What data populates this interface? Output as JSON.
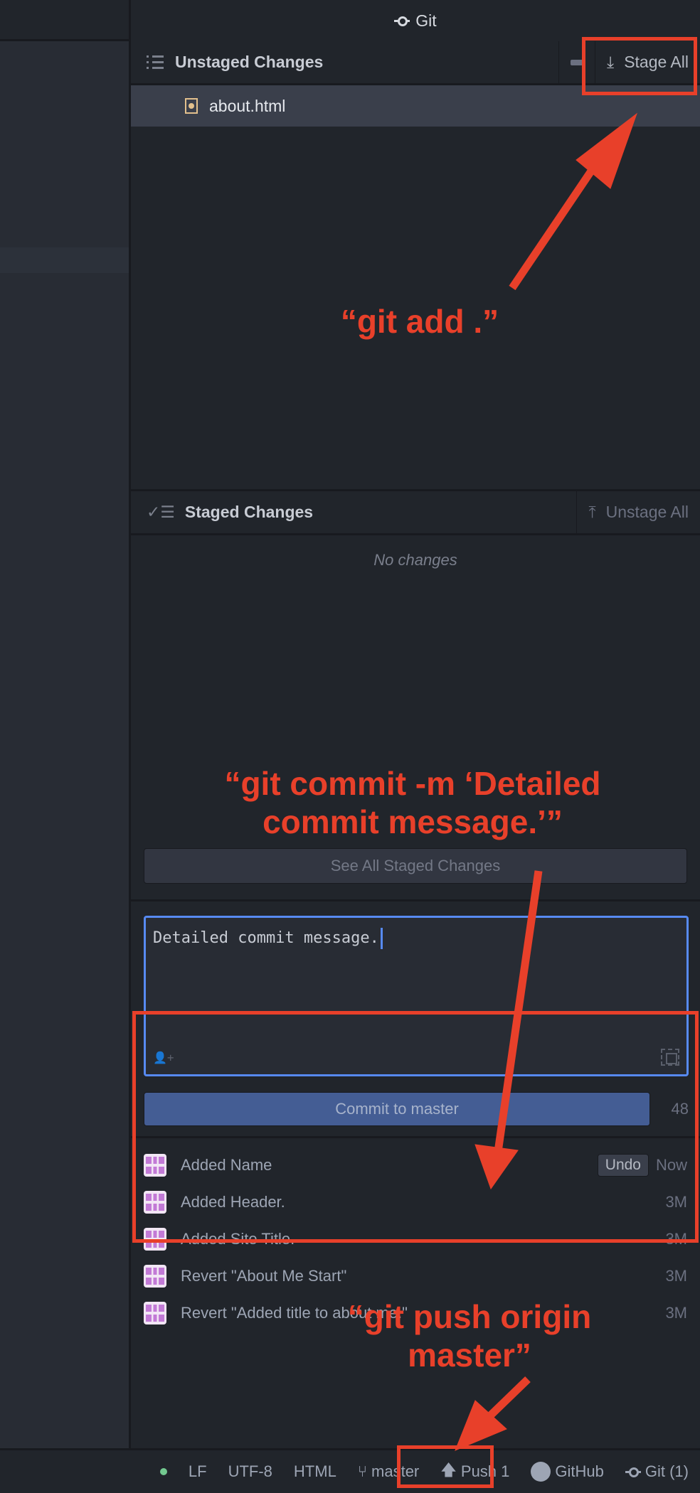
{
  "panel": {
    "title": "Git"
  },
  "unstaged": {
    "title": "Unstaged Changes",
    "stage_all_label": "Stage All",
    "files": [
      {
        "name": "about.html",
        "status": "modified"
      }
    ]
  },
  "staged": {
    "title": "Staged Changes",
    "unstage_all_label": "Unstage All",
    "empty_text": "No changes",
    "see_all_label": "See All Staged Changes"
  },
  "commit": {
    "message": "Detailed commit message.",
    "button_label": "Commit to master",
    "remaining_chars": "48"
  },
  "recent_commits": [
    {
      "message": "Added Name",
      "time": "Now",
      "undo_label": "Undo"
    },
    {
      "message": "Added Header.",
      "time": "3M"
    },
    {
      "message": "Added Site Title.",
      "time": "3M"
    },
    {
      "message": "Revert \"About Me Start\"",
      "time": "3M"
    },
    {
      "message": "Revert \"Added title to about me.\"",
      "time": "3M"
    }
  ],
  "status_bar": {
    "line_ending": "LF",
    "encoding": "UTF-8",
    "grammar": "HTML",
    "branch": "master",
    "push": "Push 1",
    "github": "GitHub",
    "git": "Git (1)"
  },
  "annotations": {
    "add": "“git add .”",
    "commit": "“git commit -m ‘Detailed commit message.’”",
    "push": "“git push origin master”",
    "color": "#e8402a"
  }
}
